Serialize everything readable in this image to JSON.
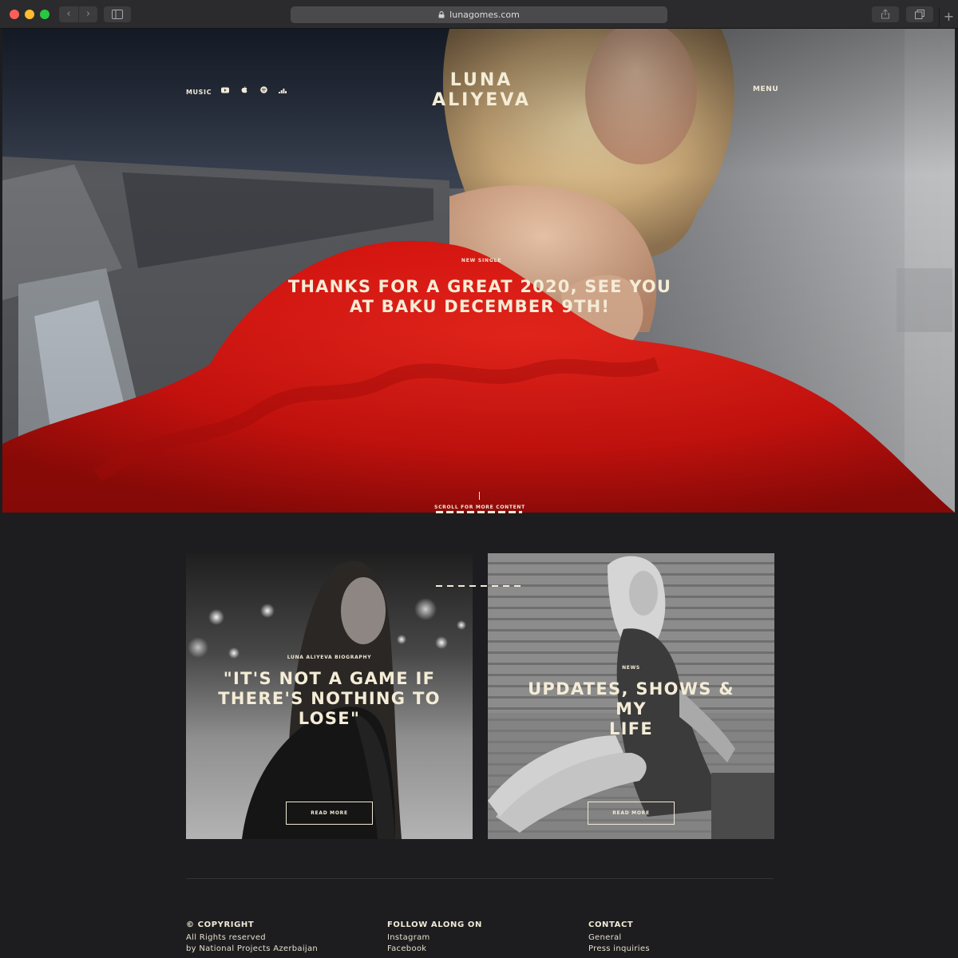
{
  "browser": {
    "url": "lunagomes.com",
    "back_glyph": "‹",
    "forward_glyph": "›",
    "new_tab_glyph": "+"
  },
  "hero": {
    "logo_line1": "LUNA",
    "logo_line2": "ALIYEVA",
    "music_label": "MUSIC",
    "platform_icons": [
      "youtube-icon",
      "apple-music-icon",
      "spotify-icon",
      "deezer-icon"
    ],
    "menu_label": "MENU",
    "eyebrow": "NEW SINGLE",
    "title_line1": "THANKS FOR A GREAT 2020, SEE YOU",
    "title_line2": "AT BAKU DECEMBER 9TH!",
    "scroll_label": "SCROLL FOR MORE CONTENT"
  },
  "cards": [
    {
      "eyebrow": "LUNA ALIYEVA BIOGRAPHY",
      "title_line1": "\"IT'S NOT A GAME IF",
      "title_line2": "THERE'S NOTHING TO",
      "title_line3": "LOSE\"",
      "button": "READ MORE"
    },
    {
      "eyebrow": "NEWS",
      "title_line1": "UPDATES, SHOWS & MY",
      "title_line2": "LIFE",
      "button": "READ MORE"
    }
  ],
  "footer": {
    "copyright": {
      "heading": "© COPYRIGHT",
      "lines": [
        "All Rights reserved",
        "by National Projects Azerbaijan"
      ]
    },
    "follow": {
      "heading": "FOLLOW ALONG ON",
      "links": [
        "Instagram",
        "Facebook"
      ]
    },
    "contact": {
      "heading": "CONTACT",
      "links": [
        "General",
        "Press inquiries"
      ]
    }
  },
  "colors": {
    "page_bg": "#1d1d1f",
    "text_cream": "#f2ead8",
    "dress_red": "#d8130f"
  }
}
